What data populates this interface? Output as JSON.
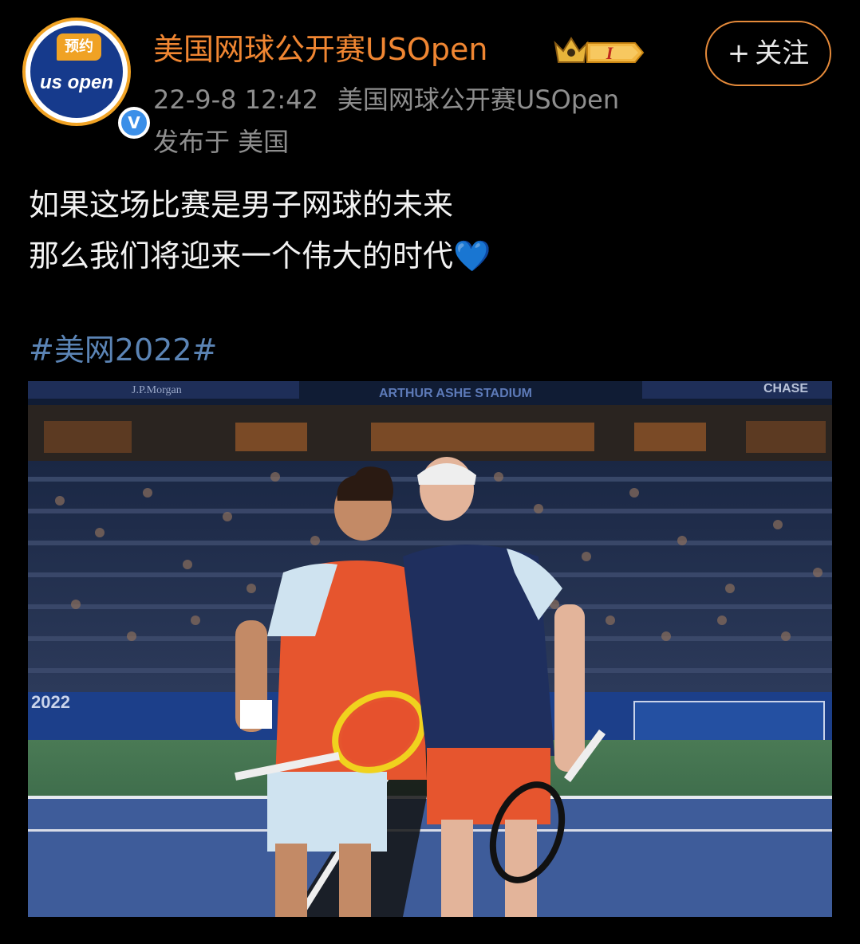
{
  "header": {
    "avatar": {
      "reserve_label": "预约",
      "logo_text": "us open",
      "verified_icon": "verified-v-icon"
    },
    "username": "美国网球公开赛USOpen",
    "level_badge": {
      "icon": "crown-level-icon",
      "label": "I"
    },
    "follow_button": {
      "icon": "plus-icon",
      "plus": "+",
      "label": "关注"
    },
    "meta": {
      "date": "22-9-8 12:42",
      "source": "美国网球公开赛USOpen"
    },
    "location": "发布于 美国"
  },
  "post": {
    "lines": [
      "如果这场比赛是男子网球的未来",
      "那么我们将迎来一个伟大的时代"
    ],
    "emoji": "💙",
    "hashtag": "#美网2022#"
  },
  "photo": {
    "signs": {
      "sponsor_left": "J.P.Morgan",
      "stadium": "ARTHUR ASHE STADIUM",
      "sponsor_right": "CHASE",
      "court_wall": "2022"
    }
  },
  "colors": {
    "background": "#000000",
    "username": "#f08632",
    "follow_border": "#e58a3a",
    "meta_text": "#8e8e8e",
    "hashtag": "#5b84b5",
    "avatar_ring": "#f0a224",
    "verified": "#3b8fe8"
  }
}
